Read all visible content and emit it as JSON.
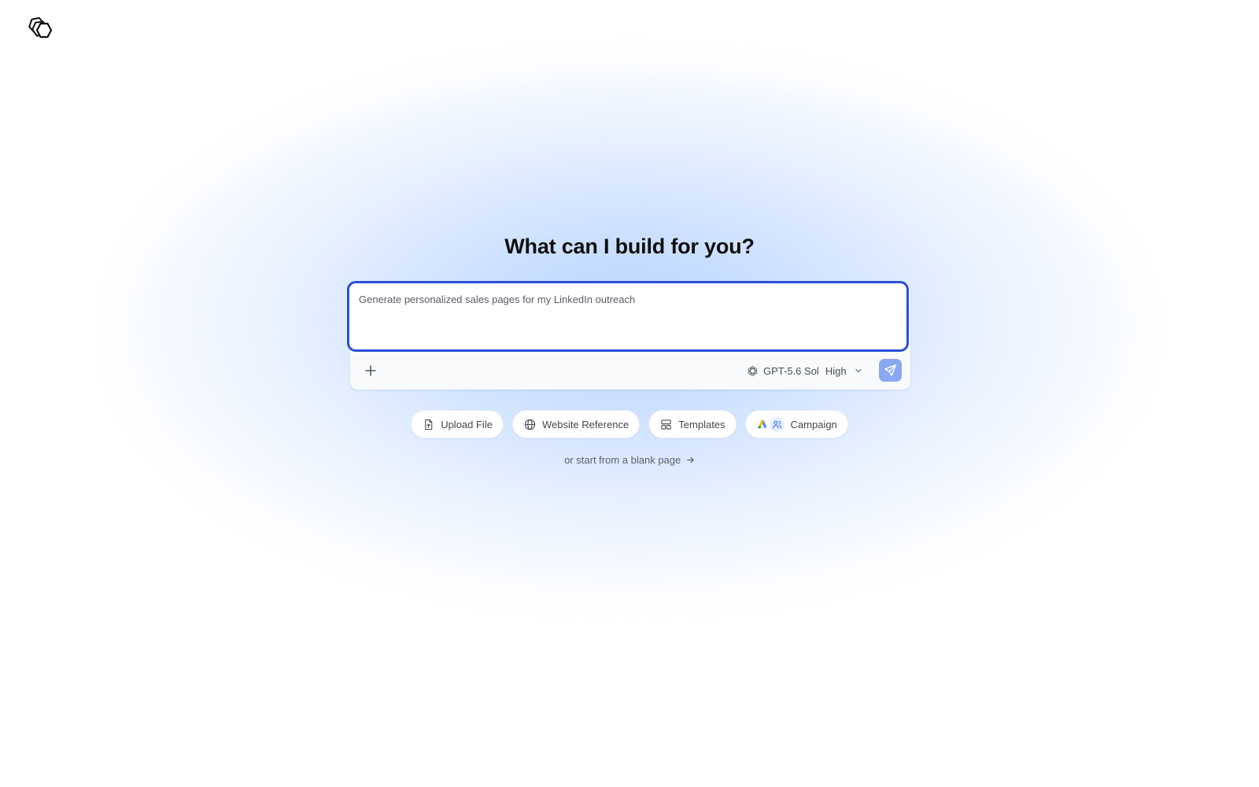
{
  "app": {
    "logo_icon": "hexagons-logo-icon"
  },
  "main": {
    "title": "What can I build for you?"
  },
  "composer": {
    "prompt_placeholder": "Generate personalized sales pages for my LinkedIn outreach",
    "prompt_value": "",
    "add_icon": "plus-icon",
    "model": {
      "icon": "openai-icon",
      "name": "GPT-5.6 Sol",
      "effort": "High",
      "dropdown_icon": "chevron-down-icon"
    },
    "send_icon": "send-icon",
    "send_color": "#8aa8f2",
    "focus_color": "#2a4fd6"
  },
  "quick_actions": [
    {
      "label": "Upload File",
      "icon": "file-upload-icon"
    },
    {
      "label": "Website Reference",
      "icon": "globe-icon"
    },
    {
      "label": "Templates",
      "icon": "layout-template-icon"
    },
    {
      "label": "Campaign",
      "icon": "google-ads-people-icon"
    }
  ],
  "blank_page": {
    "label": "or start from a blank page",
    "icon": "arrow-right-icon"
  }
}
